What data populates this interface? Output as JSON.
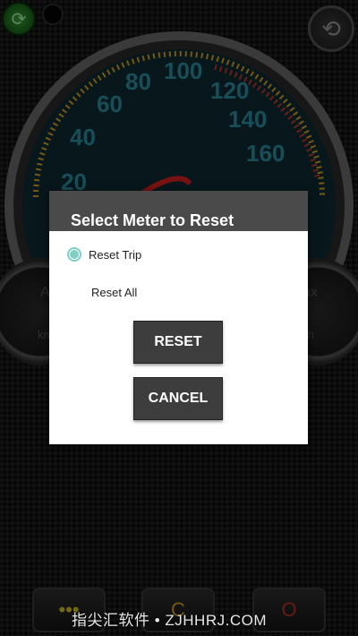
{
  "gauge": {
    "speed_labels": [
      "20",
      "40",
      "60",
      "80",
      "100",
      "120",
      "140",
      "160"
    ],
    "left_gauge_partial": [
      "A",
      "km"
    ],
    "right_gauge_partial": [
      "ax",
      "/h"
    ]
  },
  "dialog": {
    "title": "Select Meter to Reset",
    "options": [
      {
        "label": "Reset Trip",
        "selected": true
      },
      {
        "label": "Reset All",
        "selected": false
      }
    ],
    "reset_label": "RESET",
    "cancel_label": "CANCEL"
  },
  "bottom_bar": {
    "menu_glyph": "•••",
    "refresh_glyph": "C",
    "power_glyph": "O"
  },
  "watermark": "指尖汇软件 • ZJHHRJ.COM",
  "colors": {
    "accent": "#7fcfc5",
    "gauge_numbers": "#2b7f8f",
    "dialog_button": "#3d3d3d"
  }
}
